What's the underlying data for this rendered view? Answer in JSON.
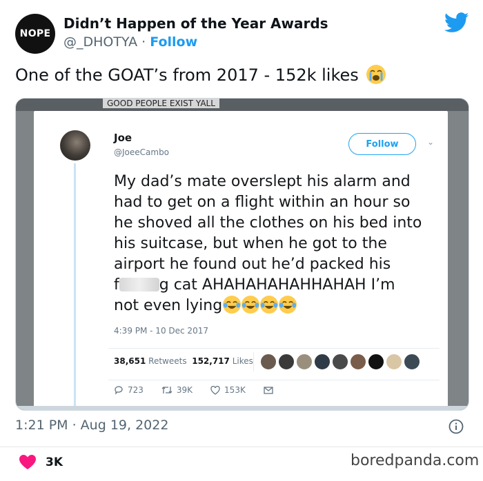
{
  "author": {
    "avatar_text": "NOPE",
    "name": "Didn’t Happen of the Year Awards",
    "handle": "@_DHOTYA",
    "separator": " · ",
    "follow_label": "Follow"
  },
  "tweet": {
    "text": "One of the GOAT’s from 2017 - 152k likes",
    "emoji": "loudly-crying-face"
  },
  "embedded": {
    "band_label": "GOOD PEOPLE EXIST YALL",
    "name": "Joe",
    "handle": "@JoeeCambo",
    "follow_label": "Follow",
    "body_lines": [
      "My dad’s mate overslept his alarm and",
      "had to get on a flight within an hour so",
      "he shoved all the clothes on his bed into",
      "his suitcase, but when he got to the",
      "airport he found out he’d packed his"
    ],
    "line6_start": "f",
    "line6_end": "g cat AHAHAHAHAHHAHAH  I’m",
    "line7": "not even lying",
    "timestamp": "4:39 PM - 10 Dec 2017",
    "retweets_count": "38,651",
    "retweets_label": "Retweets",
    "likes_count": "152,717",
    "likes_label": "Likes",
    "replies": "723",
    "retweets_short": "39K",
    "likes_short": "153K"
  },
  "footer": {
    "timestamp": "1:21 PM · Aug 19, 2022",
    "like_count": "3K",
    "brand": "boredpanda.com"
  },
  "colors": {
    "twitter_blue": "#1d9bf0",
    "heart": "#f91880"
  }
}
